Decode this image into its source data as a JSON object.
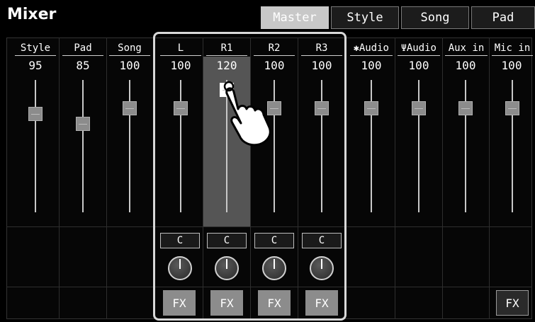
{
  "app": {
    "title": "Mixer"
  },
  "tabs": [
    {
      "label": "Master",
      "active": true
    },
    {
      "label": "Style",
      "active": false
    },
    {
      "label": "Song",
      "active": false
    },
    {
      "label": "Pad",
      "active": false
    }
  ],
  "channels": [
    {
      "label": "Style",
      "value": "95",
      "level": 95
    },
    {
      "label": "Pad",
      "value": "85",
      "level": 85
    },
    {
      "label": "Song",
      "value": "100",
      "level": 100
    },
    {
      "label": "L",
      "value": "100",
      "level": 100,
      "pan": "C",
      "fx": "FX"
    },
    {
      "label": "R1",
      "value": "120",
      "level": 120,
      "pan": "C",
      "fx": "FX",
      "selected": true
    },
    {
      "label": "R2",
      "value": "100",
      "level": 100,
      "pan": "C",
      "fx": "FX"
    },
    {
      "label": "R3",
      "value": "100",
      "level": 100,
      "pan": "C",
      "fx": "FX"
    },
    {
      "label": "Audio",
      "value": "100",
      "level": 100,
      "icon": "bluetooth-icon"
    },
    {
      "label": "Audio",
      "value": "100",
      "level": 100,
      "icon": "usb-icon"
    },
    {
      "label": "Aux in",
      "value": "100",
      "level": 100
    },
    {
      "label": "Mic in",
      "value": "100",
      "level": 100,
      "fx": "FX"
    }
  ],
  "colors": {
    "active_tab": "#c8c8c8",
    "selected_column": "#555555",
    "fx_button": "#8c8c8c"
  }
}
